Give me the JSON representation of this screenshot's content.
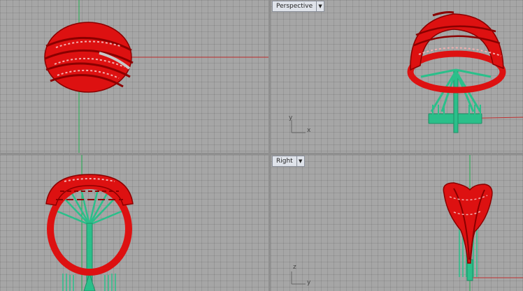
{
  "viewports": {
    "top": {
      "label": ""
    },
    "perspective": {
      "label": "Perspective",
      "axis_x": "x",
      "axis_y": "y"
    },
    "front": {
      "label": ""
    },
    "right": {
      "label": "Right",
      "axis_z": "z",
      "axis_y": "y"
    }
  },
  "colors": {
    "background": "#a6a6a6",
    "separator": "#8f8f8f",
    "ring": "#dd1111",
    "ring_dark": "#8a0000",
    "supports": "#2bbf8a",
    "axis_green": "#20b050",
    "axis_red": "#c03030"
  },
  "icons": {
    "viewport_menu": "dropdown-arrow-icon"
  }
}
